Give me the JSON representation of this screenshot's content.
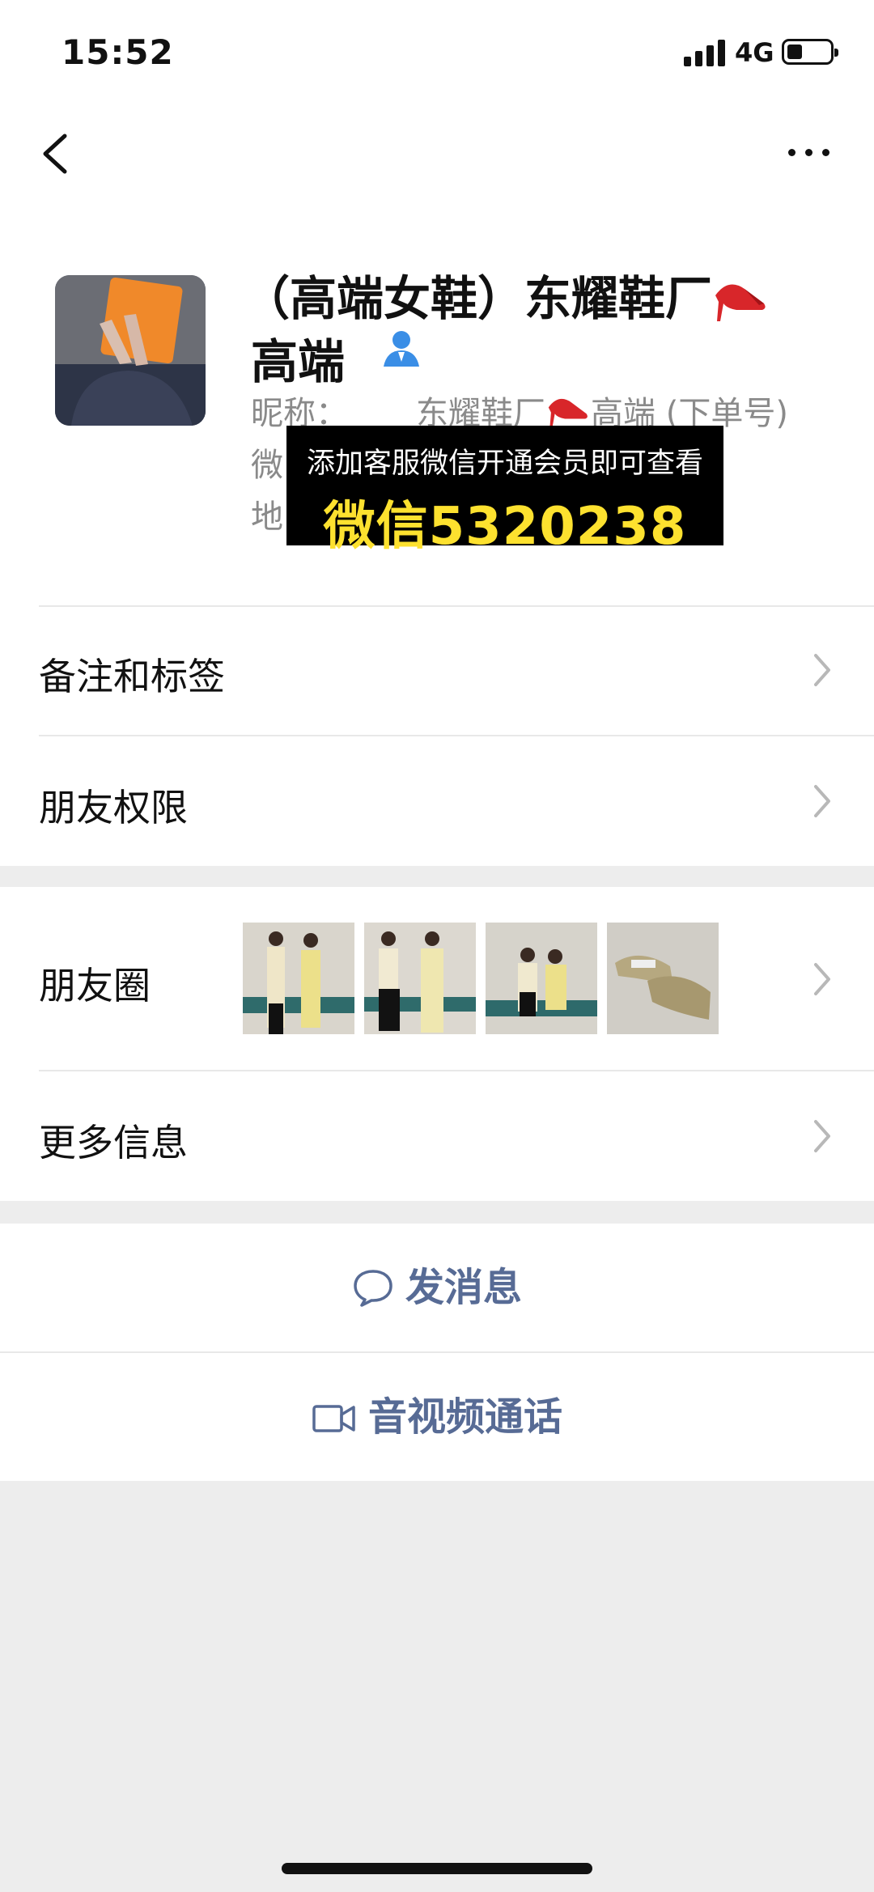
{
  "status_bar": {
    "time": "15:52",
    "network": "4G",
    "battery_level": 0.35
  },
  "profile": {
    "name_line1": "（高端女鞋）东耀鞋厂",
    "name_line2": "高端",
    "nickname_label": "昵称：",
    "nickname_value": "东耀鞋厂",
    "nickname_suffix": "高端 (下单号)",
    "wechat_label_partial": "微",
    "region_label_partial": "地"
  },
  "overlay": {
    "line1": "添加客服微信开通会员即可查看",
    "line2": "微信5320238"
  },
  "rows": {
    "remarks": "备注和标签",
    "permissions": "朋友权限",
    "moments": "朋友圈",
    "more_info": "更多信息"
  },
  "actions": {
    "message": "发消息",
    "call": "音视频通话"
  },
  "icons": [
    "back-icon",
    "more-icon",
    "verified-person-icon",
    "high-heel-icon",
    "chevron-right-icon",
    "chat-bubble-icon",
    "video-camera-icon"
  ],
  "colors": {
    "link_blue": "#576b95",
    "overlay_yellow": "#fde12f",
    "page_bg": "#ededed"
  }
}
